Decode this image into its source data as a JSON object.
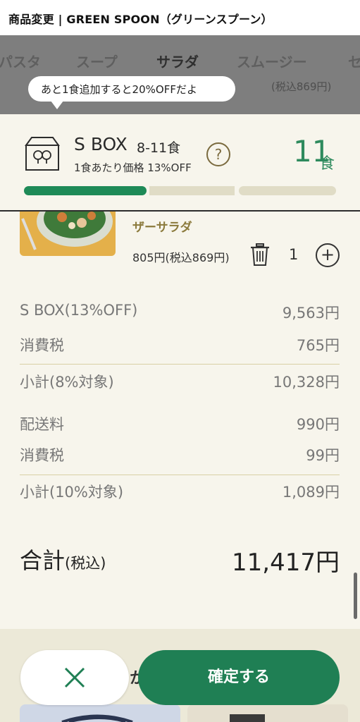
{
  "header": {
    "title": "商品変更 | GREEN SPOON（グリーンスプーン）"
  },
  "categories": {
    "tabs": [
      "パスタ",
      "スープ",
      "サラダ",
      "スムージー",
      "セ"
    ],
    "active": "サラダ",
    "peek_text": "(税込869円)"
  },
  "tooltip": {
    "text": "あと1食追加すると20%OFFだよ"
  },
  "box": {
    "name": "S BOX",
    "range": "8-11食",
    "discount_text": "1食あたり価格 13%OFF",
    "help_symbol": "?",
    "count": "11",
    "count_unit": "食",
    "progress_segments": 3,
    "progress_filled": 1
  },
  "item": {
    "name": "ザーサラダ",
    "price": "805円(税込869円)",
    "quantity": "1",
    "plus_symbol": "+"
  },
  "summary": {
    "rows": [
      {
        "label": "S BOX(13%OFF)",
        "value": "9,563円"
      },
      {
        "label": "消費税",
        "value": "765円"
      },
      {
        "label": "小計(8%対象)",
        "value": "10,328円"
      },
      {
        "label": "配送料",
        "value": "990円"
      },
      {
        "label": "消費税",
        "value": "99円"
      },
      {
        "label": "小計(10%対象)",
        "value": "1,089円"
      }
    ],
    "total_label": "合計",
    "total_sub": "(税込)",
    "total_value": "11,417円"
  },
  "footer": {
    "confirm_label": "確定する",
    "peek_char": "か"
  },
  "colors": {
    "accent": "#1f7f54",
    "count": "#2e8a5d",
    "overlay": "#7e7e7e",
    "background": "#f7f5ec"
  }
}
